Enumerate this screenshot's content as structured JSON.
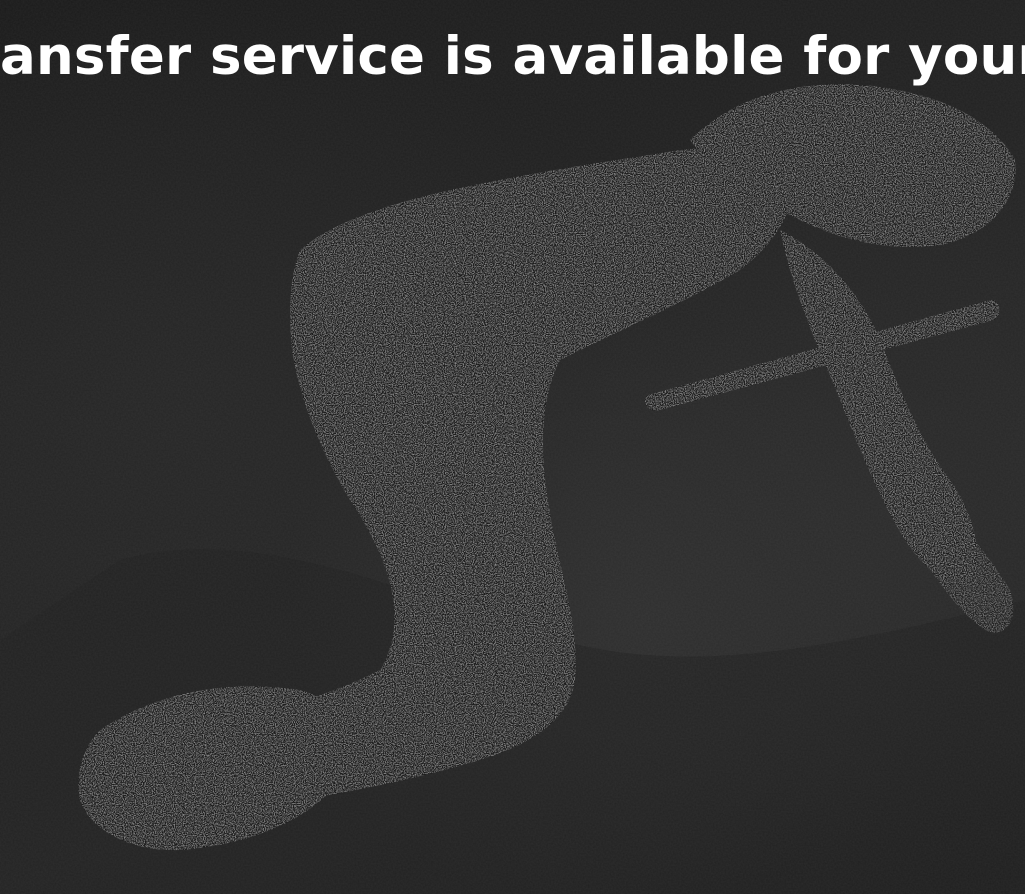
{
  "hero": {
    "headline": "ansfer service is available for your",
    "image_description_icon": "silhouette-figure-with-sword-image"
  },
  "colors": {
    "background": "#1b1b1b",
    "text": "#ffffff",
    "figure": "#131313"
  }
}
